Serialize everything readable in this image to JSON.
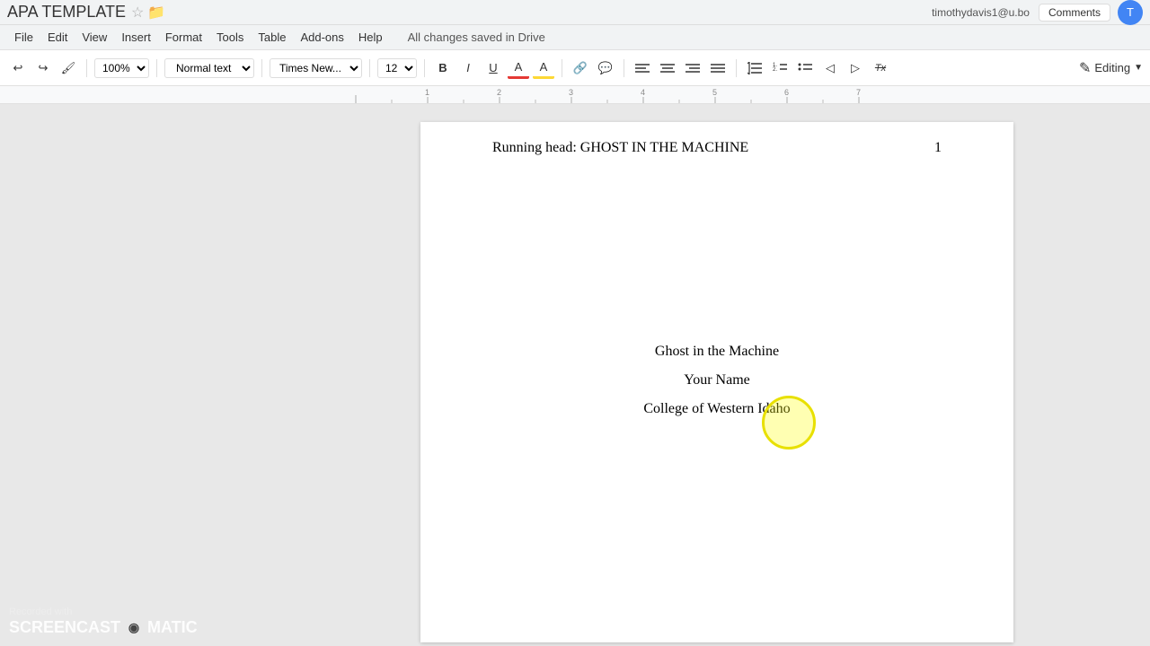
{
  "titlebar": {
    "doc_title": "APA TEMPLATE",
    "star_icon": "☆",
    "folder_icon": "📁",
    "user_email": "timothydavis1@u.bo",
    "comments_label": "Comments"
  },
  "menubar": {
    "items": [
      "File",
      "Edit",
      "View",
      "Insert",
      "Format",
      "Tools",
      "Table",
      "Add-ons",
      "Help"
    ],
    "save_status": "All changes saved in Drive"
  },
  "toolbar": {
    "undo_icon": "↩",
    "redo_icon": "↪",
    "paintformat_icon": "🖌",
    "zoom_value": "100%",
    "style_value": "Normal text",
    "font_value": "Times New...",
    "fontsize_value": "12",
    "bold_label": "B",
    "italic_label": "I",
    "underline_label": "U",
    "textcolor_label": "A",
    "highlight_label": "A",
    "link_icon": "🔗",
    "comment_icon": "💬",
    "align_left": "≡",
    "align_center": "≡",
    "align_right": "≡",
    "align_justify": "≡",
    "linespacing_icon": "↕",
    "numberedlist_icon": "1.",
    "bulletlist_icon": "•",
    "dedent_icon": "◁",
    "indent_icon": "▷",
    "clearformat_icon": "Tx",
    "editing_icon": "✎",
    "editing_label": "Editing"
  },
  "page": {
    "running_head": "Running head: GHOST IN THE MACHINE",
    "page_number": "1",
    "title_line": "Ghost in the Machine",
    "author_line": "Your Name",
    "institution_line": "College of Western Idaho"
  },
  "watermark": {
    "recorded_with": "Recorded with",
    "brand_name": "SCREENCAST",
    "brand_suffix": "MATIC"
  }
}
